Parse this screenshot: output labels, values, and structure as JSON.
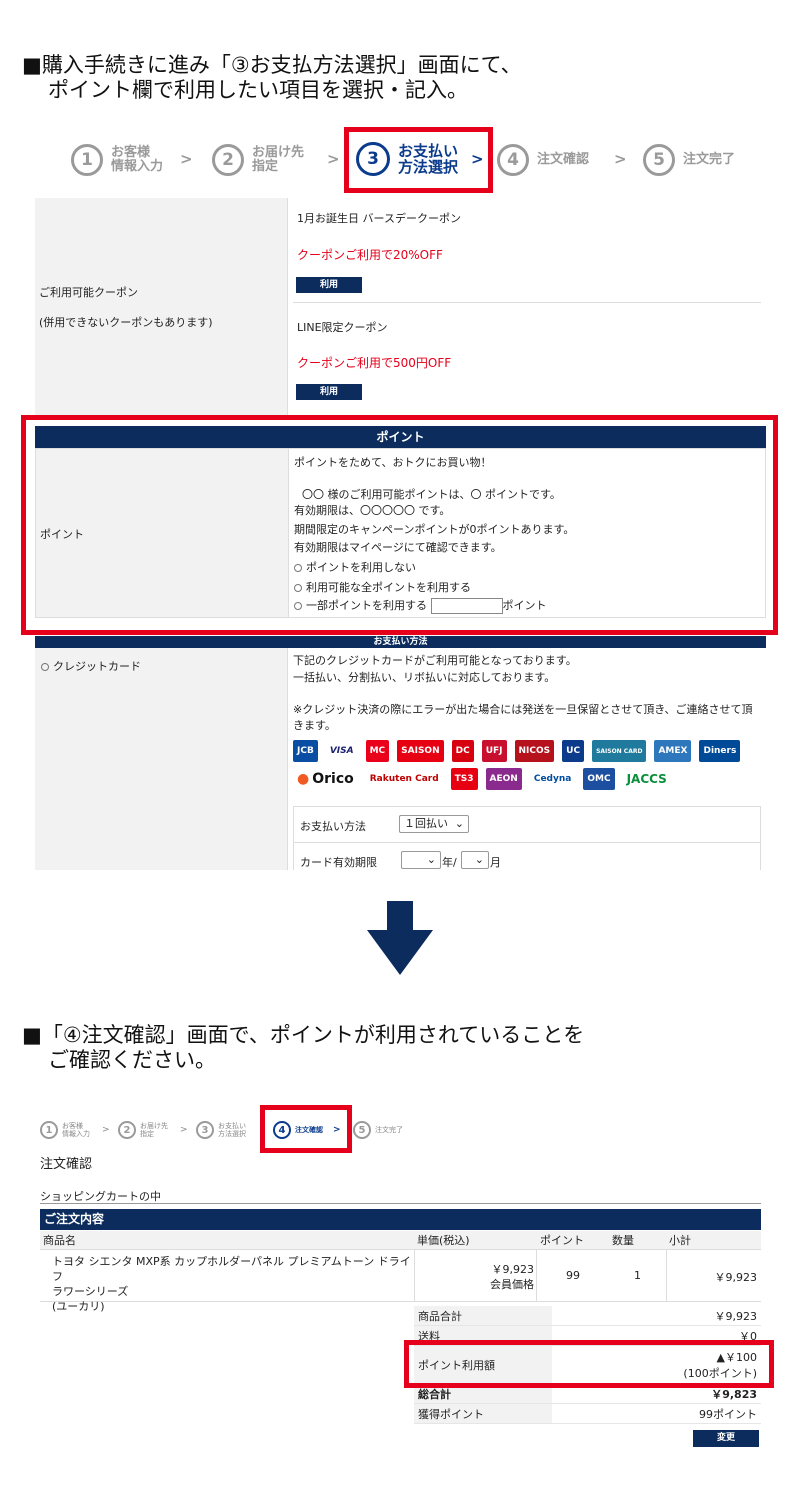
{
  "heading1": {
    "line1": "■購入手続きに進み「③お支払方法選択」画面にて、",
    "line2": "ポイント欄で利用したい項目を選択・記入。"
  },
  "steps": [
    {
      "num": "1",
      "l1": "お客様",
      "l2": "情報入力"
    },
    {
      "num": "2",
      "l1": "お届け先",
      "l2": "指定"
    },
    {
      "num": "3",
      "l1": "お支払い",
      "l2": "方法選択"
    },
    {
      "num": "4",
      "l1": "注文確認",
      "l2": ""
    },
    {
      "num": "5",
      "l1": "注文完了",
      "l2": ""
    }
  ],
  "chevron": ">",
  "coupon": {
    "label": "ご利用可能クーポン",
    "note": "(併用できないクーポンもあります)",
    "items": [
      {
        "name": "1月お誕生日 バースデークーポン",
        "discount": "クーポンご利用で20%OFF",
        "button": "利用"
      },
      {
        "name": "LINE限定クーポン",
        "discount": "クーポンご利用で500円OFF",
        "button": "利用"
      }
    ]
  },
  "points": {
    "header": "ポイント",
    "label": "ポイント",
    "lines": [
      "ポイントをためて、おトクにお買い物！",
      "〇〇 様のご利用可能ポイントは、〇 ポイントです。",
      "有効期限は、〇〇〇〇〇 です。",
      "期間限定のキャンペーンポイントが0ポイントあります。",
      "有効期限はマイページにて確認できます。"
    ],
    "options": [
      "ポイントを利用しない",
      "利用可能な全ポイントを利用する",
      "一部ポイントを利用する"
    ],
    "unit": "ポイント"
  },
  "payment": {
    "header": "お支払い方法",
    "option": "クレジットカード",
    "lines": [
      "下記のクレジットカードがご利用可能となっております。",
      "一括払い、分割払い、リボ払いに対応しております。",
      "※クレジット決済の際にエラーが出た場合には発送を一旦保留とさせて頂き、ご連絡させて頂きます。"
    ],
    "cards": [
      "JCB",
      "VISA",
      "MC",
      "SAISON",
      "DC",
      "UFJ",
      "NICOS",
      "UC",
      "SAISON CARD",
      "AMEX",
      "Diners",
      "Orico",
      "Rakuten Card",
      "TS3",
      "AEON",
      "Cedyna",
      "OMC",
      "JACCS"
    ],
    "method_label": "お支払い方法",
    "method_value": "１回払い",
    "expiry_label": "カード有効期限",
    "year_unit": "年/",
    "month_unit": "月"
  },
  "heading2": {
    "line1": "■「④注文確認」画面で、ポイントが利用されていることを",
    "line2": "ご確認ください。"
  },
  "confirm": {
    "title": "注文確認",
    "cart_label": "ショッピングカートの中",
    "band": "ご注文内容",
    "cols": [
      "商品名",
      "単価(税込)",
      "ポイント",
      "数量",
      "小計"
    ],
    "product": {
      "name1": "トヨタ シエンタ MXP系 カップホルダーパネル プレミアムトーン ドライフ",
      "name2": "ラワーシリーズ",
      "name3": "(ユーカリ)",
      "price": "￥9,923",
      "price_note": "会員価格",
      "points": "99",
      "qty": "1",
      "subtotal": "￥9,923"
    },
    "summary": [
      {
        "label": "商品合計",
        "value": "￥9,923",
        "sub": ""
      },
      {
        "label": "送料",
        "value": "￥0",
        "sub": ""
      },
      {
        "label": "ポイント利用額",
        "value": "▲￥100",
        "sub": "(100ポイント)"
      },
      {
        "label": "総合計",
        "value": "￥9,823",
        "sub": ""
      },
      {
        "label": "獲得ポイント",
        "value": "99ポイント",
        "sub": ""
      }
    ],
    "change_button": "変更"
  },
  "colors": {
    "navy": "#0b2c5d",
    "accent_blue": "#0b3b8c",
    "highlight_red": "#e5001b"
  }
}
